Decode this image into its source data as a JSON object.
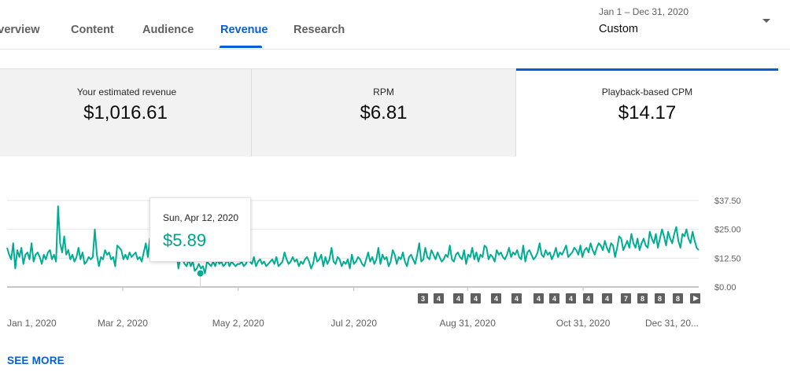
{
  "tabs": [
    {
      "label": "Overview",
      "active": false
    },
    {
      "label": "Content",
      "active": false
    },
    {
      "label": "Audience",
      "active": false
    },
    {
      "label": "Revenue",
      "active": true
    },
    {
      "label": "Research",
      "active": false
    }
  ],
  "date_range": {
    "range_text": "Jan 1 – Dec 31, 2020",
    "selected": "Custom"
  },
  "metrics": [
    {
      "label": "Your estimated revenue",
      "value": "$1,016.61",
      "selected": false
    },
    {
      "label": "RPM",
      "value": "$6.81",
      "selected": false
    },
    {
      "label": "Playback-based CPM",
      "value": "$14.17",
      "selected": true
    }
  ],
  "tooltip": {
    "date": "Sun, Apr 12, 2020",
    "value": "$5.89"
  },
  "see_more_label": "SEE MORE",
  "colors": {
    "accent": "#065fd4",
    "series": "#00ad92"
  },
  "chart_data": {
    "type": "line",
    "x_start": "2020-01-01",
    "x_end": "2020-12-31",
    "xlabel": "",
    "ylabel": "",
    "ylim": [
      0,
      37.5
    ],
    "yticks": [
      "$0.00",
      "$12.50",
      "$25.00",
      "$37.50"
    ],
    "xticks": [
      "Jan 1, 2020",
      "Mar 2, 2020",
      "May 2, 2020",
      "Jul 2, 2020",
      "Aug 31, 2020",
      "Oct 31, 2020",
      "Dec 31, 20..."
    ],
    "highlight": {
      "date": "2020-04-12",
      "value": 5.89
    },
    "series": [
      {
        "values": [
          17,
          14,
          12,
          19,
          8,
          16,
          13,
          17,
          10,
          14,
          15,
          12,
          19,
          11,
          14,
          15,
          13,
          10,
          14,
          12,
          15,
          16,
          12,
          14,
          11,
          35,
          19,
          15,
          22,
          14,
          16,
          12,
          14,
          11,
          13,
          17,
          12,
          15,
          10,
          11,
          13,
          12,
          13,
          25,
          14,
          9,
          13,
          12,
          16,
          14,
          15,
          12,
          13,
          9,
          18,
          17,
          16,
          12,
          14,
          12,
          15,
          13,
          14,
          15,
          12,
          13,
          11,
          15,
          19,
          13,
          21,
          17,
          13,
          14,
          13,
          15,
          14,
          16,
          12,
          12,
          14,
          14,
          13,
          15,
          8,
          13,
          12,
          10,
          9,
          12,
          9,
          11,
          7,
          8,
          10,
          8,
          9,
          5.89,
          11,
          10,
          9,
          11,
          9,
          12,
          10,
          11,
          9,
          10,
          12,
          9,
          11,
          10,
          9,
          10,
          10,
          11,
          9,
          10,
          12,
          11,
          10,
          13,
          9,
          11,
          12,
          10,
          11,
          9,
          10,
          11,
          12,
          10,
          13,
          9,
          10,
          11,
          15,
          12,
          10,
          11,
          13,
          11,
          12,
          9,
          11,
          10,
          12,
          13,
          11,
          8,
          10,
          15,
          11,
          12,
          14,
          9,
          13,
          10,
          12,
          17,
          11,
          10,
          13,
          12,
          9,
          11,
          10,
          12,
          8,
          14,
          10,
          11,
          13,
          12,
          10,
          9,
          12,
          15,
          11,
          13,
          10,
          12,
          17,
          10,
          14,
          12,
          13,
          9,
          11,
          16,
          14,
          10,
          13,
          12,
          15,
          11,
          9,
          13,
          14,
          12,
          10,
          14,
          19,
          11,
          12,
          17,
          13,
          12,
          16,
          14,
          12,
          15,
          13,
          11,
          12,
          14,
          13,
          18,
          12,
          11,
          14,
          15,
          13,
          12,
          16,
          10,
          14,
          13,
          17,
          12,
          15,
          11,
          14,
          13,
          18,
          17,
          12,
          14,
          13,
          11,
          16,
          14,
          15,
          13,
          12,
          14,
          17,
          13,
          15,
          14,
          16,
          13,
          12,
          18,
          11,
          15,
          16,
          14,
          12,
          13,
          15,
          19,
          14,
          13,
          16,
          14,
          15,
          12,
          14,
          17,
          13,
          15,
          14,
          16,
          18,
          13,
          14,
          15,
          17,
          16,
          14,
          18,
          13,
          16,
          17,
          15,
          19,
          16,
          14,
          17,
          19,
          18,
          16,
          20,
          17,
          15,
          19,
          18,
          13,
          17,
          22,
          21,
          16,
          18,
          20,
          17,
          23,
          19,
          17,
          21,
          16,
          19,
          21,
          18,
          17,
          24,
          21,
          19,
          23,
          17,
          21,
          25,
          22,
          18,
          24,
          21,
          19,
          23,
          26,
          20,
          17,
          23,
          22,
          25,
          21,
          19,
          24,
          20,
          17,
          16
        ]
      }
    ]
  },
  "footer_badges": [
    "3",
    "4",
    "4",
    "4",
    "4",
    "4",
    "4",
    "4",
    "4",
    "4",
    "4",
    "7",
    "8",
    "8",
    "8"
  ]
}
